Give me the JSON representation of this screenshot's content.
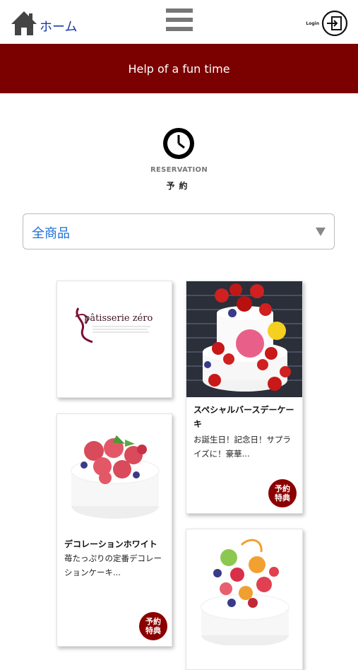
{
  "header": {
    "home_label": "ホーム",
    "login_label": "Login"
  },
  "banner": {
    "text": "Help of a fun time"
  },
  "reservation": {
    "title_en": "RESERVATION",
    "title_jp": "予約"
  },
  "filter": {
    "selected": "全商品"
  },
  "logo": {
    "brand": "pâtisserie zéro"
  },
  "products": [
    {
      "name": "スペシャルバースデーケーキ",
      "desc": "お誕生日！記念日！サプライズに！豪華...",
      "badge_line1": "予約",
      "badge_line2": "特典"
    },
    {
      "name": "デコレーションホワイト",
      "desc": "苺たっぷりの定番デコレーションケーキ...",
      "badge_line1": "予約",
      "badge_line2": "特典"
    }
  ],
  "colors": {
    "banner": "#7b0000",
    "badge": "#8b0000",
    "link": "#1a6ed8"
  }
}
